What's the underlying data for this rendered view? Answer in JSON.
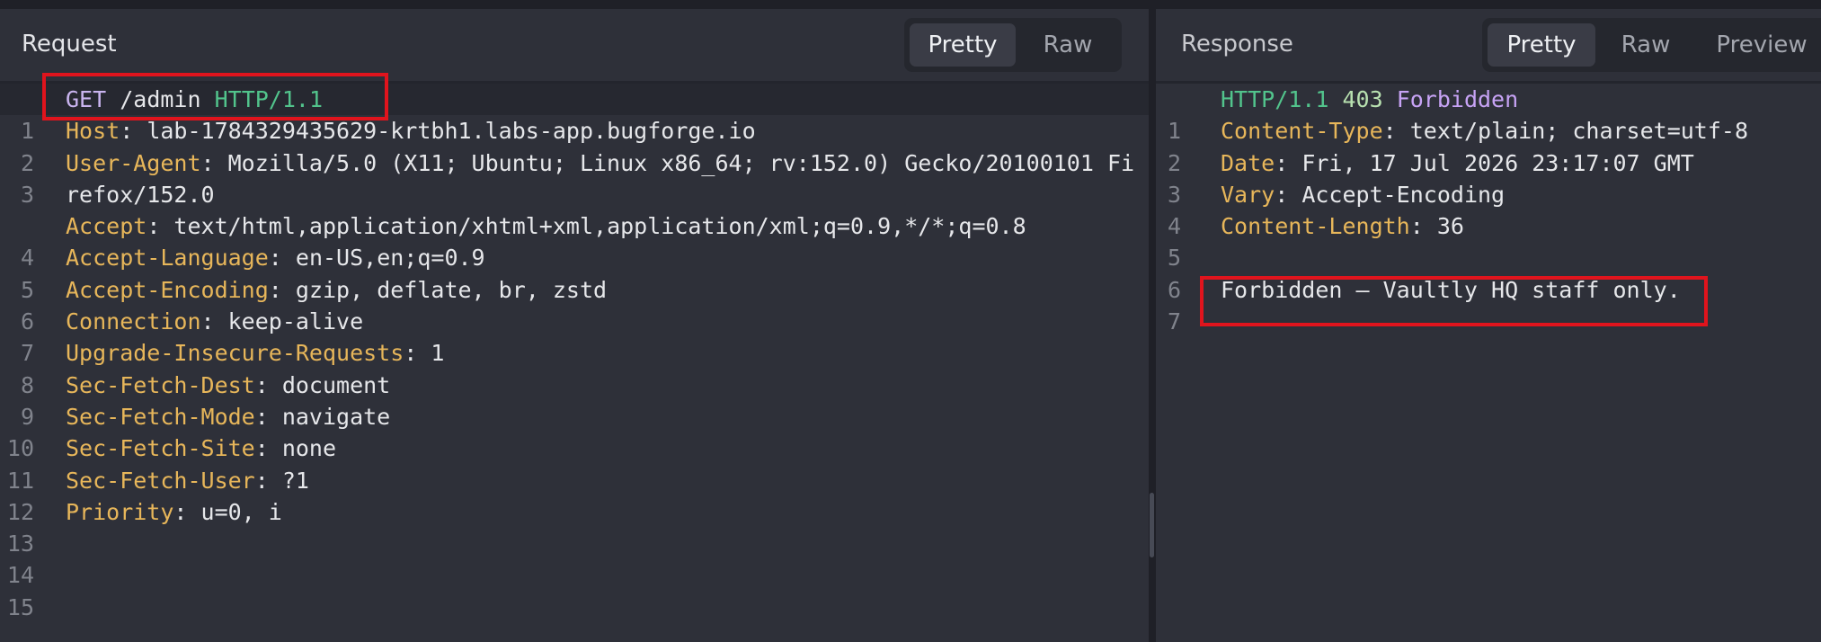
{
  "request": {
    "title": "Request",
    "tabs": [
      {
        "label": "Pretty",
        "active": true
      },
      {
        "label": "Raw",
        "active": false
      }
    ],
    "request_line": {
      "method": "GET",
      "path": "/admin",
      "protocol": "HTTP/1.1"
    },
    "headers": [
      {
        "name": "Host",
        "value": "lab-1784329435629-krtbh1.labs-app.bugforge.io"
      },
      {
        "name": "User-Agent",
        "value": "Mozilla/5.0 (X11; Ubuntu; Linux x86_64; rv:152.0) Gecko/20100101 Fi",
        "value_cont": "refox/152.0"
      },
      {
        "name": "Accept",
        "value": "text/html,application/xhtml+xml,application/xml;q=0.9,*/*;q=0.8"
      },
      {
        "name": "Accept-Language",
        "value": "en-US,en;q=0.9"
      },
      {
        "name": "Accept-Encoding",
        "value": "gzip, deflate, br, zstd"
      },
      {
        "name": "Connection",
        "value": "keep-alive"
      },
      {
        "name": "Upgrade-Insecure-Requests",
        "value": "1"
      },
      {
        "name": "Sec-Fetch-Dest",
        "value": "document"
      },
      {
        "name": "Sec-Fetch-Mode",
        "value": "navigate"
      },
      {
        "name": "Sec-Fetch-Site",
        "value": "none"
      },
      {
        "name": "Sec-Fetch-User",
        "value": "?1"
      },
      {
        "name": "Priority",
        "value": "u=0, i"
      }
    ],
    "line_numbers": [
      "1",
      "2",
      "3",
      "4",
      "5",
      "6",
      "7",
      "8",
      "9",
      "10",
      "11",
      "12",
      "13",
      "14",
      "15"
    ]
  },
  "response": {
    "title": "Response",
    "tabs": [
      {
        "label": "Pretty",
        "active": true
      },
      {
        "label": "Raw",
        "active": false
      },
      {
        "label": "Preview",
        "active": false
      }
    ],
    "status_line": {
      "protocol": "HTTP/1.1",
      "code": "403",
      "text": "Forbidden"
    },
    "headers": [
      {
        "name": "Content-Type",
        "value": "text/plain; charset=utf-8"
      },
      {
        "name": "Date",
        "value": "Fri, 17 Jul 2026 23:17:07 GMT"
      },
      {
        "name": "Vary",
        "value": "Accept-Encoding"
      },
      {
        "name": "Content-Length",
        "value": "36"
      }
    ],
    "body": "Forbidden — Vaultly HQ staff only.",
    "line_numbers": [
      "1",
      "2",
      "3",
      "4",
      "5",
      "6",
      "7"
    ]
  },
  "colors": {
    "highlight_box": "#e0141d",
    "header_name": "#e7b65a",
    "protocol": "#52c48c",
    "method": "#c9b4ef"
  }
}
